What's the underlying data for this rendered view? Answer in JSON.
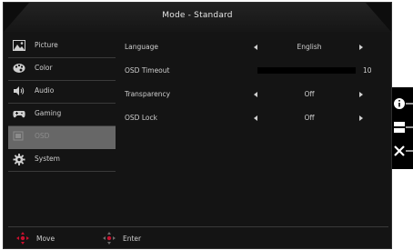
{
  "osd": {
    "title": "Mode - Standard",
    "sidebar": [
      {
        "label": "Picture",
        "icon": "picture-icon",
        "active": false
      },
      {
        "label": "Color",
        "icon": "color-palette-icon",
        "active": false
      },
      {
        "label": "Audio",
        "icon": "speaker-icon",
        "active": false
      },
      {
        "label": "Gaming",
        "icon": "gamepad-icon",
        "active": false
      },
      {
        "label": "OSD",
        "icon": "osd-icon",
        "active": true
      },
      {
        "label": "System",
        "icon": "gear-icon",
        "active": false
      }
    ],
    "settings": [
      {
        "name": "Language",
        "value": "English"
      },
      {
        "name": "OSD Timeout",
        "value": "10",
        "level": 1.0
      },
      {
        "name": "Transparency",
        "value": "Off"
      },
      {
        "name": "OSD Lock",
        "value": "Off"
      }
    ],
    "footer": {
      "move_label": "Move",
      "enter_label": "Enter"
    }
  },
  "hotkeys": [
    "info-icon",
    "menu-icon",
    "close-icon"
  ],
  "colors": {
    "accent": "#c8102e",
    "panel": "#141414",
    "active": "#676767"
  }
}
